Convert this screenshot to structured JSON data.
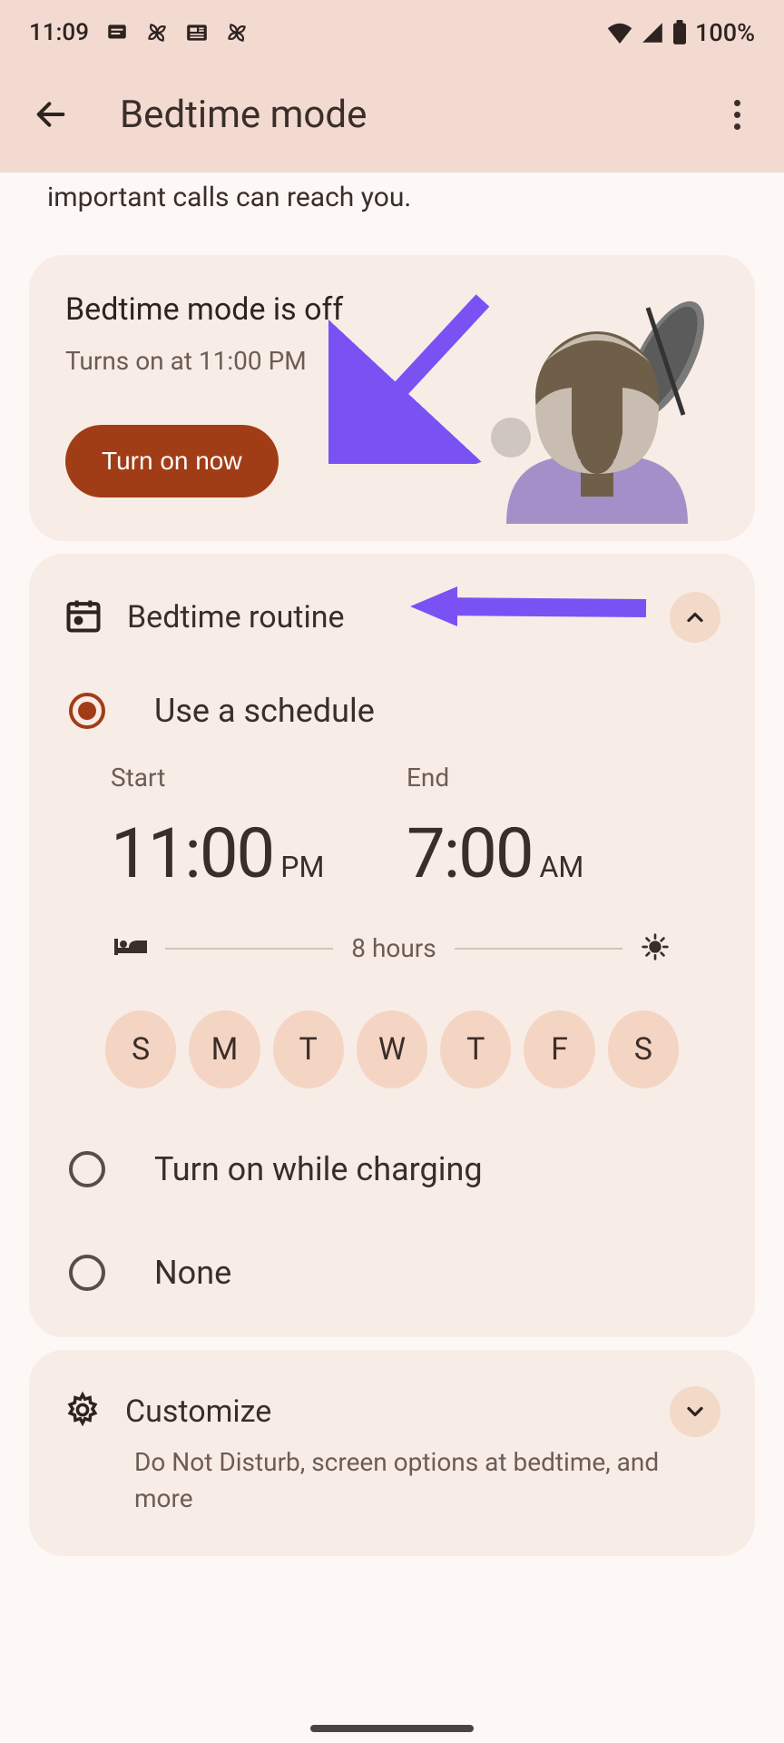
{
  "status_bar": {
    "time": "11:09",
    "battery_pct": "100%"
  },
  "header": {
    "title": "Bedtime mode"
  },
  "intro": "important calls can reach you.",
  "status_card": {
    "title": "Bedtime mode is off",
    "subtitle": "Turns on at 11:00 PM",
    "button": "Turn on now"
  },
  "routine": {
    "title": "Bedtime routine",
    "options": {
      "schedule": "Use a schedule",
      "charging": "Turn on while charging",
      "none": "None"
    },
    "start_label": "Start",
    "end_label": "End",
    "start_time": "11:00",
    "start_ampm": "PM",
    "end_time": "7:00",
    "end_ampm": "AM",
    "duration": "8 hours",
    "days": [
      "S",
      "M",
      "T",
      "W",
      "T",
      "F",
      "S"
    ]
  },
  "customize": {
    "title": "Customize",
    "subtitle": "Do Not Disturb, screen options at bedtime, and more"
  }
}
